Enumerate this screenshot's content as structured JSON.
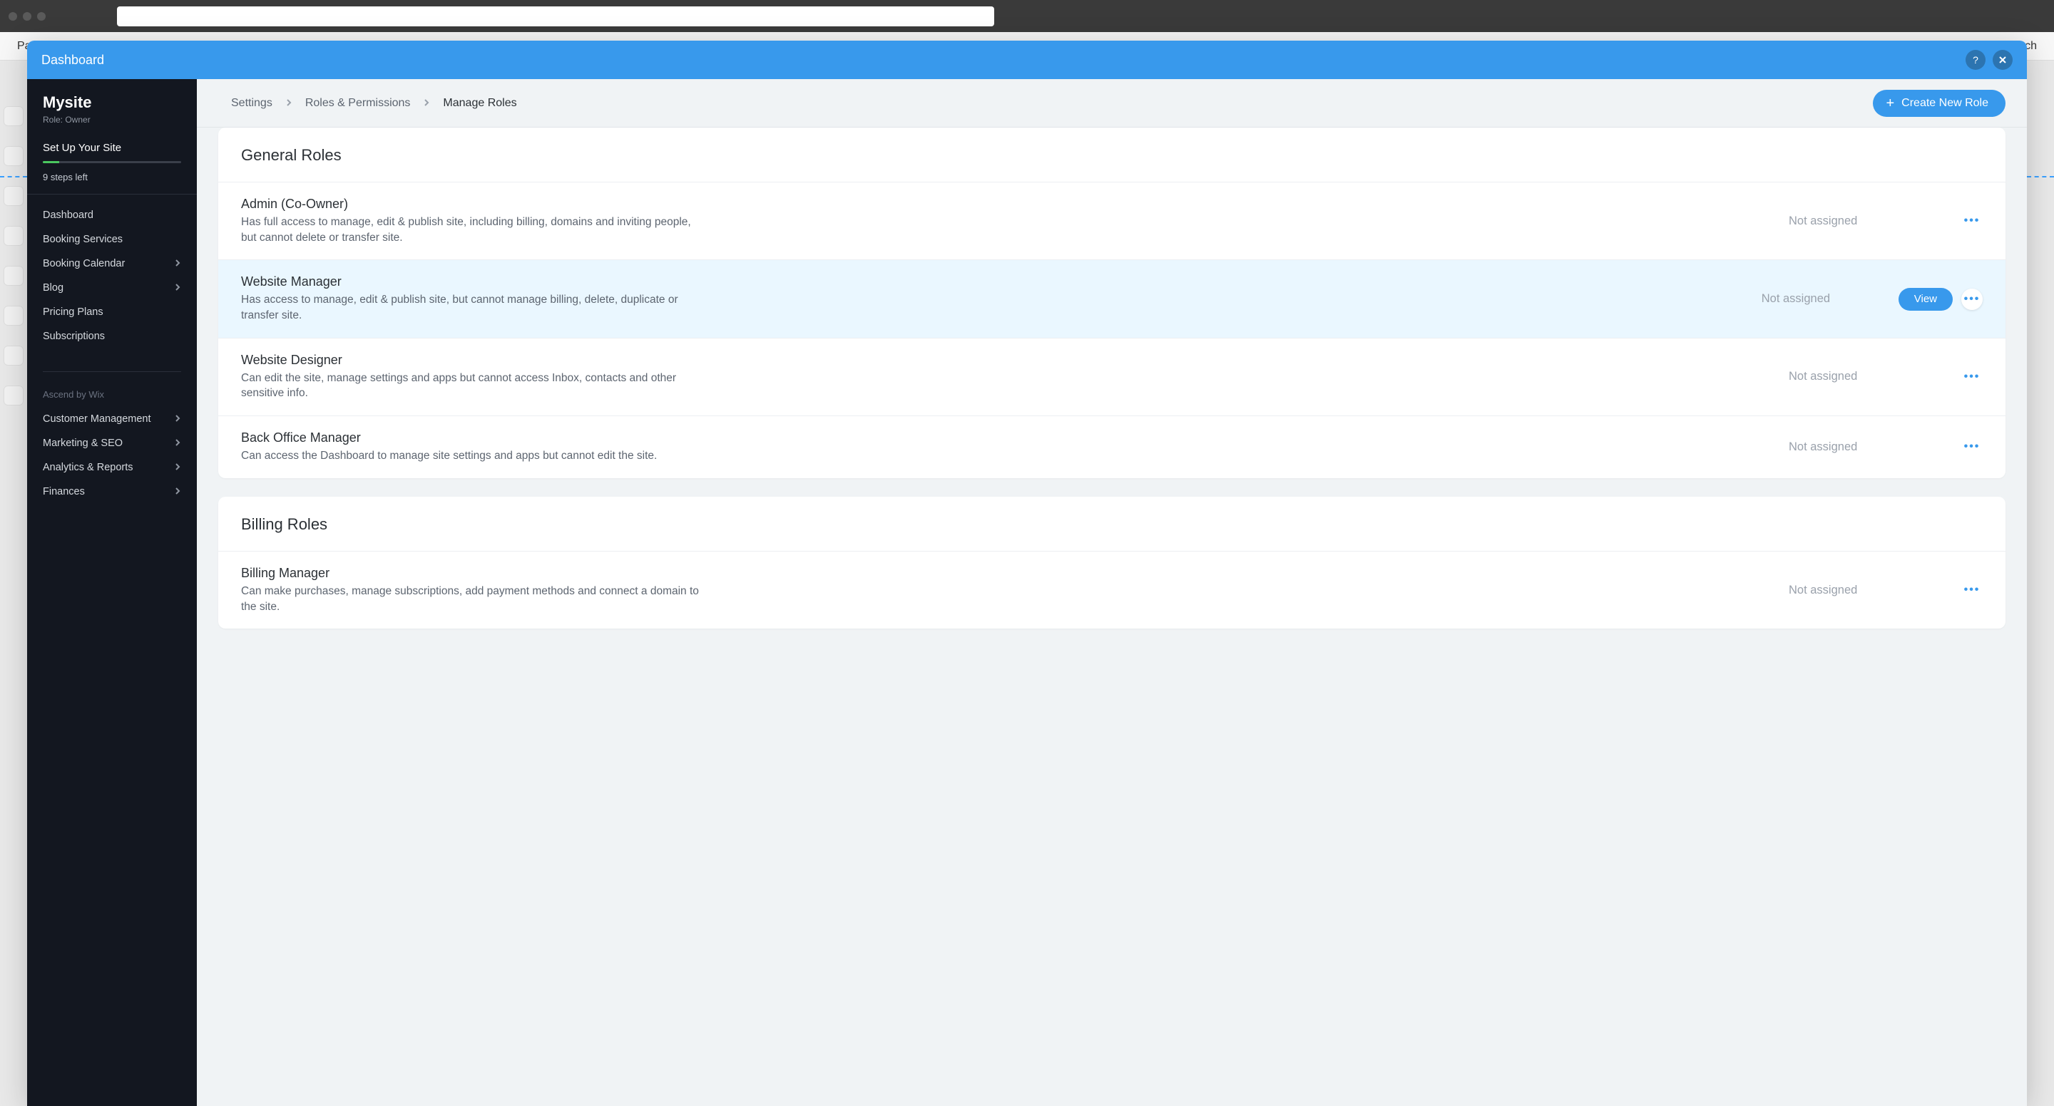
{
  "bg": {
    "left": "Pa",
    "right": "rch"
  },
  "panel_header": {
    "title": "Dashboard",
    "help_tooltip": "?",
    "close_tooltip": "Close"
  },
  "sidebar": {
    "site_name": "Mysite",
    "role_label": "Role: Owner",
    "setup_title": "Set Up Your Site",
    "steps_left": "9 steps left",
    "items": [
      {
        "label": "Dashboard",
        "chevron": false
      },
      {
        "label": "Booking Services",
        "chevron": false
      },
      {
        "label": "Booking Calendar",
        "chevron": true
      },
      {
        "label": "Blog",
        "chevron": true
      },
      {
        "label": "Pricing Plans",
        "chevron": false
      },
      {
        "label": "Subscriptions",
        "chevron": false
      }
    ],
    "section_heading": "Ascend by Wix",
    "items2": [
      {
        "label": "Customer Management",
        "chevron": true
      },
      {
        "label": "Marketing & SEO",
        "chevron": true
      },
      {
        "label": "Analytics & Reports",
        "chevron": true
      },
      {
        "label": "Finances",
        "chevron": true
      }
    ]
  },
  "breadcrumb": {
    "items": [
      "Settings",
      "Roles & Permissions",
      "Manage Roles"
    ]
  },
  "create_button": "Create New Role",
  "sections": [
    {
      "title": "General Roles",
      "roles": [
        {
          "name": "Admin (Co-Owner)",
          "desc": "Has full access to manage, edit & publish site, including billing, domains and inviting people, but cannot delete or transfer site.",
          "status": "Not assigned",
          "hover": false
        },
        {
          "name": "Website Manager",
          "desc": "Has access to manage, edit & publish site, but cannot manage billing, delete, duplicate or transfer site.",
          "status": "Not assigned",
          "hover": true
        },
        {
          "name": "Website Designer",
          "desc": "Can edit the site, manage settings and apps but cannot access Inbox, contacts and other sensitive info.",
          "status": "Not assigned",
          "hover": false
        },
        {
          "name": "Back Office Manager",
          "desc": "Can access the Dashboard to manage site settings and apps but cannot edit the site.",
          "status": "Not assigned",
          "hover": false
        }
      ]
    },
    {
      "title": "Billing Roles",
      "roles": [
        {
          "name": "Billing Manager",
          "desc": "Can make purchases, manage subscriptions, add payment methods and connect a domain to the site.",
          "status": "Not assigned",
          "hover": false
        }
      ]
    }
  ],
  "labels": {
    "view": "View"
  }
}
